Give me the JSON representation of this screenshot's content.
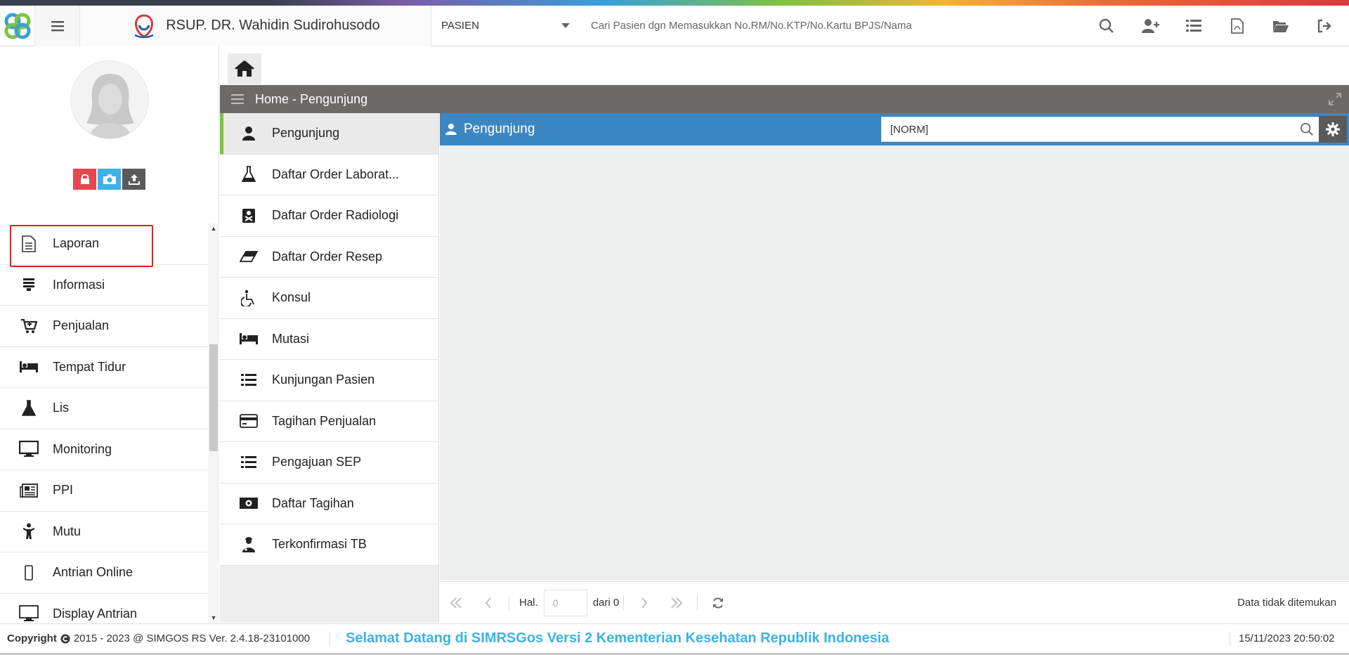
{
  "header": {
    "hospital_name": "RSUP. DR. Wahidin Sudirohusodo",
    "search_type": "PASIEN",
    "search_placeholder": "Cari Pasien dgn Memasukkan No.RM/No.KTP/No.Kartu BPJS/Nama",
    "icons": [
      "search-icon",
      "add-user-icon",
      "list-icon",
      "pdf-icon",
      "folder-open-icon",
      "logout-icon"
    ]
  },
  "sidebar": {
    "avatar_buttons": [
      "lock-icon",
      "camera-icon",
      "upload-icon"
    ],
    "items": [
      {
        "label": "Laporan",
        "icon": "document-icon"
      },
      {
        "label": "Informasi",
        "icon": "stack-icon"
      },
      {
        "label": "Penjualan",
        "icon": "cart-icon"
      },
      {
        "label": "Tempat Tidur",
        "icon": "bed-icon"
      },
      {
        "label": "Lis",
        "icon": "flask-icon"
      },
      {
        "label": "Monitoring",
        "icon": "monitor-icon"
      },
      {
        "label": "PPI",
        "icon": "newspaper-icon"
      },
      {
        "label": "Mutu",
        "icon": "child-icon"
      },
      {
        "label": "Antrian Online",
        "icon": "mobile-icon"
      },
      {
        "label": "Display Antrian",
        "icon": "desktop-icon"
      }
    ]
  },
  "panel": {
    "title": "Home - Pengunjung"
  },
  "submenu": {
    "items": [
      {
        "label": "Pengunjung",
        "icon": "user-icon"
      },
      {
        "label": "Daftar Order Laborat...",
        "icon": "flask-icon"
      },
      {
        "label": "Daftar Order Radiologi",
        "icon": "xray-icon"
      },
      {
        "label": "Daftar Order Resep",
        "icon": "eraser-icon"
      },
      {
        "label": "Konsul",
        "icon": "wheelchair-icon"
      },
      {
        "label": "Mutasi",
        "icon": "bed-icon"
      },
      {
        "label": "Kunjungan Pasien",
        "icon": "list-icon"
      },
      {
        "label": "Tagihan Penjualan",
        "icon": "credit-card-icon"
      },
      {
        "label": "Pengajuan SEP",
        "icon": "list-icon"
      },
      {
        "label": "Daftar Tagihan",
        "icon": "money-icon"
      },
      {
        "label": "Terkonfirmasi TB",
        "icon": "doctor-icon"
      }
    ]
  },
  "content": {
    "title": "Pengunjung",
    "search_value": "[NORM]"
  },
  "pager": {
    "page_label": "Hal.",
    "page_value": "0",
    "of_label": "dari 0",
    "status": "Data tidak ditemukan"
  },
  "footer": {
    "copyright": "2015 - 2023 @ SIMGOS RS Ver. 2.4.18-23101000",
    "copyright_prefix": "Copyright",
    "marquee": "Selamat Datang di SIMRSGos Versi 2 Kementerian Kesehatan Republik Indonesia",
    "datetime": "15/11/2023 20:50:02"
  },
  "colors": {
    "panel_header": "#6d6969",
    "content_header": "#3c87c2",
    "active_accent": "#7ec242",
    "highlight_border": "#e02020",
    "marquee": "#3cb2e6"
  }
}
